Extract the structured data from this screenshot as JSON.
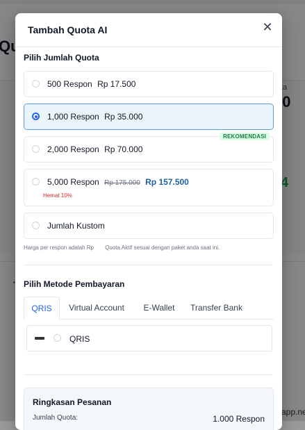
{
  "modal": {
    "title": "Tambah Quota AI",
    "close_glyph": "✕"
  },
  "quota": {
    "section_label": "Pilih Jumlah Quota",
    "options": [
      {
        "amount": "500 Respon",
        "price": "Rp 17.500",
        "selected": false
      },
      {
        "amount": "1,000 Respon",
        "price": "Rp 35.000",
        "selected": true
      },
      {
        "amount": "2,000 Respon",
        "price": "Rp 70.000",
        "selected": false,
        "badge": "REKOMENDASI"
      },
      {
        "amount": "5,000 Respon",
        "original_price": "Rp 175.000",
        "discount_price": "Rp 157.500",
        "savings": "Hemat 10%",
        "selected": false
      },
      {
        "amount": "Jumlah Kustom",
        "selected": false
      }
    ],
    "note_left": "Harga per respon adalah Rp",
    "note_right": "Quota Aktif sesuai dengan paket anda saat ini."
  },
  "payment": {
    "section_label": "Pilih Metode Pembayaran",
    "tabs": [
      "QRIS",
      "Virtual Account",
      "E-Wallet",
      "Transfer Bank"
    ],
    "active_tab": "QRIS",
    "method_label": "QRIS",
    "logo_icon": "qris-logo-icon"
  },
  "summary": {
    "title": "Ringkasan Pesanan",
    "quota_key": "Jumlah Quota:",
    "quota_value": "1.000 Respon"
  },
  "background": {
    "title_fragment": "Qu",
    "right_label": "ta",
    "right_number": "00",
    "right_green": "4",
    "bottom_right": "app.ne"
  },
  "colors": {
    "accent": "#2563eb",
    "selected_bg": "#eaf4fb",
    "badge_bg": "#dcfce7",
    "badge_text": "#15803d",
    "discount": "#1e5f9e",
    "savings": "#dc2626"
  }
}
